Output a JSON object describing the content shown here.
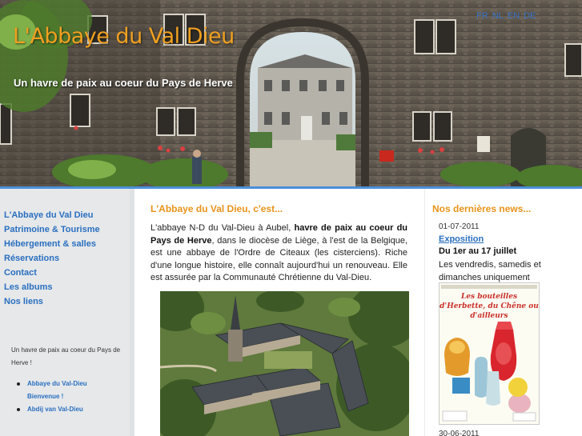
{
  "header": {
    "title": "L'Abbaye du Val Dieu",
    "tagline": "Un havre de paix au coeur du Pays de Herve",
    "languages": [
      "FR",
      "NL",
      "EN",
      "DE"
    ]
  },
  "sidebar": {
    "nav": [
      {
        "label": "L'Abbaye du Val Dieu"
      },
      {
        "label": "Patrimoine & Tourisme"
      },
      {
        "label": "Hébergement & salles"
      },
      {
        "label": "Réservations"
      },
      {
        "label": "Contact"
      },
      {
        "label": "Les albums"
      },
      {
        "label": "Nos liens"
      }
    ],
    "intro": "Un havre de paix au coeur du Pays de Herve !",
    "links": [
      {
        "label": "Abbaye du Val-Dieu"
      },
      {
        "label": "Bienvenue !"
      },
      {
        "label": "Abdij van Val-Dieu"
      }
    ]
  },
  "main": {
    "heading": "L'Abbaye du Val Dieu, c'est...",
    "paragraph": {
      "part1": "L'abbaye N-D du Val-Dieu à Aubel, ",
      "bold": "havre de paix au coeur du Pays de Herve",
      "part2": ", dans le diocèse de Liège, à l'est de la Belgique, est une abbaye de l'Ordre de Citeaux (les cisterciens). Riche d'une longue histoire, elle connaît aujourd'hui un renouveau. Elle est assurée par la Communauté Chrétienne du Val-Dieu."
    }
  },
  "news": {
    "heading": "Nos dernières news...",
    "items": [
      {
        "date": "01-07-2011",
        "title": "Exposition",
        "subtitle": "Du 1er au 17 juillet",
        "body": "Les vendredis, samedis et dimanches uniquement",
        "poster_title": "Les bouteilles d'Herbette, du Chêne ou d'ailleurs"
      },
      {
        "date": "30-06-2011"
      }
    ]
  },
  "colors": {
    "title_orange": "#f0a020",
    "heading_orange": "#e8931a",
    "link_blue": "#2a6fbf",
    "accent_rule": "#4a90d9",
    "sidebar_bg": "#e6e8ea"
  }
}
